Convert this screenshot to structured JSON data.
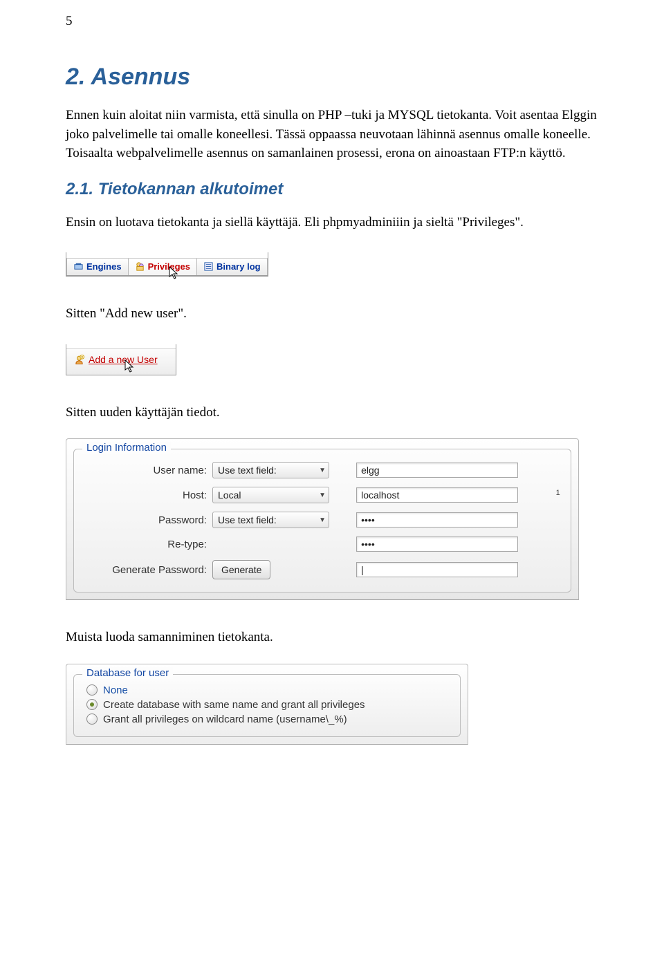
{
  "page_number": "5",
  "h1": "2. Asennus",
  "para1": "Ennen kuin aloitat niin varmista, että sinulla on PHP –tuki ja MYSQL tietokanta. Voit asentaa Elggin joko palvelimelle tai omalle koneellesi. Tässä oppaassa neuvotaan lähinnä asennus omalle koneelle. Toisaalta webpalvelimelle asennus on samanlainen prosessi, erona on ainoastaan FTP:n käyttö.",
  "h2": "2.1. Tietokannan alkutoimet",
  "para2": "Ensin on luotava tietokanta ja siellä käyttäjä. Eli phpmyadminiiin ja sieltä \"Privileges\".",
  "tabs": {
    "engines": "Engines",
    "privileges": "Privileges",
    "binary_log": "Binary log"
  },
  "p_add_new_user_text": "Sitten \"Add new user\".",
  "add_new_user_link": "Add a new User",
  "p_new_user_details": "Sitten uuden käyttäjän tiedot.",
  "login_form": {
    "legend": "Login Information",
    "labels": {
      "username": "User name:",
      "host": "Host:",
      "password": "Password:",
      "retype": "Re-type:",
      "generate": "Generate Password:"
    },
    "selects": {
      "username_mode": "Use text field:",
      "host_mode": "Local",
      "password_mode": "Use text field:"
    },
    "values": {
      "username": "elgg",
      "host": "localhost",
      "password": "••••",
      "retype": "••••",
      "generated": ""
    },
    "sup": "1",
    "generate_btn": "Generate"
  },
  "p_create_db": "Muista luoda samanniminen tietokanta.",
  "db_for_user": {
    "legend": "Database for user",
    "options": {
      "none": "None",
      "create_same": "Create database with same name and grant all privileges",
      "grant_wildcard": "Grant all privileges on wildcard name (username\\_%)"
    },
    "selected_index": 1
  }
}
